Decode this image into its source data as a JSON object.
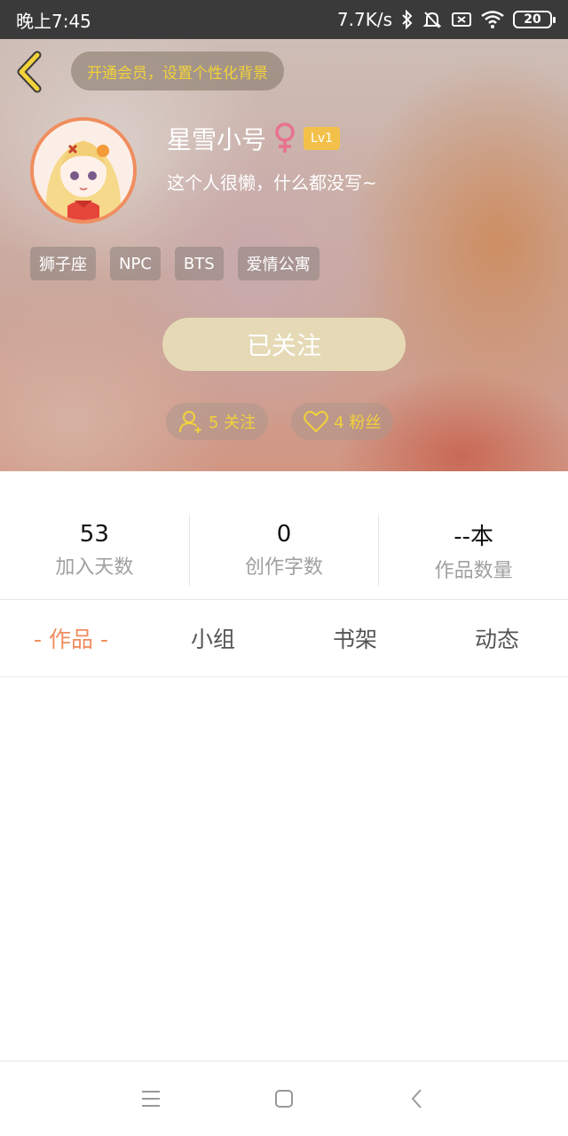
{
  "status_bar": {
    "time": "晚上7:45",
    "network_speed": "7.7K/s",
    "battery_level": "20"
  },
  "header": {
    "vip_prompt": "开通会员，设置个性化背景",
    "username": "星雪小号",
    "gender_symbol": "female-icon",
    "level": "Lv1",
    "bio": "这个人很懒，什么都没写~",
    "tags": [
      "狮子座",
      "NPC",
      "BTS",
      "爱情公寓"
    ],
    "follow_button": "已关注",
    "following_count": "5 关注",
    "fans_count": "4 粉丝",
    "colors": {
      "accent_yellow": "#f2d23a",
      "avatar_ring": "#f08d5e",
      "gender_pink": "#e8718f",
      "level_badge": "#f3c14a"
    }
  },
  "stats": [
    {
      "value": "53",
      "label": "加入天数"
    },
    {
      "value": "0",
      "label": "创作字数"
    },
    {
      "value": "--本",
      "label": "作品数量"
    }
  ],
  "tabs": [
    {
      "label": "- 作品 -",
      "active": true
    },
    {
      "label": "小组",
      "active": false
    },
    {
      "label": "书架",
      "active": false
    },
    {
      "label": "动态",
      "active": false
    }
  ],
  "nav_bar": {
    "icons": [
      "menu-icon",
      "home-square-icon",
      "back-chevron-icon"
    ]
  }
}
